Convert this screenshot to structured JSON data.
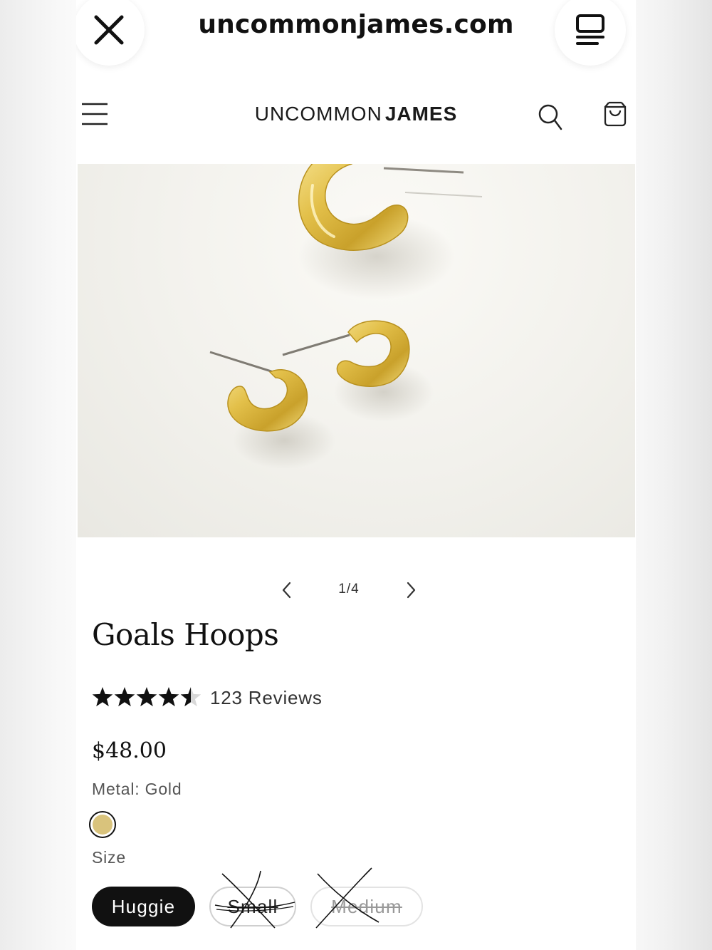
{
  "browser": {
    "url": "uncommonjames.com",
    "close_icon": "close-icon",
    "reader_icon": "reader-mode-icon"
  },
  "header": {
    "logo_light": "UNCOMMON",
    "logo_bold": "JAMES",
    "menu_icon": "hamburger-menu-icon",
    "search_icon": "search-icon",
    "cart_icon": "shopping-bag-icon"
  },
  "carousel": {
    "counter": "1/4",
    "current": 1,
    "total": 4
  },
  "product": {
    "title": "Goals Hoops",
    "rating": 4.5,
    "rating_max": 5,
    "reviews": "123 Reviews",
    "price": "$48.00",
    "metal_label": "Metal: Gold",
    "swatch_color": "#d9c37c",
    "size_label": "Size",
    "sizes": [
      {
        "label": "Huggie",
        "selected": true,
        "available": true
      },
      {
        "label": "Small",
        "selected": false,
        "available": false
      },
      {
        "label": "Medium",
        "selected": false,
        "available": false
      }
    ]
  },
  "colors": {
    "gold": "#d9b33c",
    "selected_bg": "#111111"
  }
}
